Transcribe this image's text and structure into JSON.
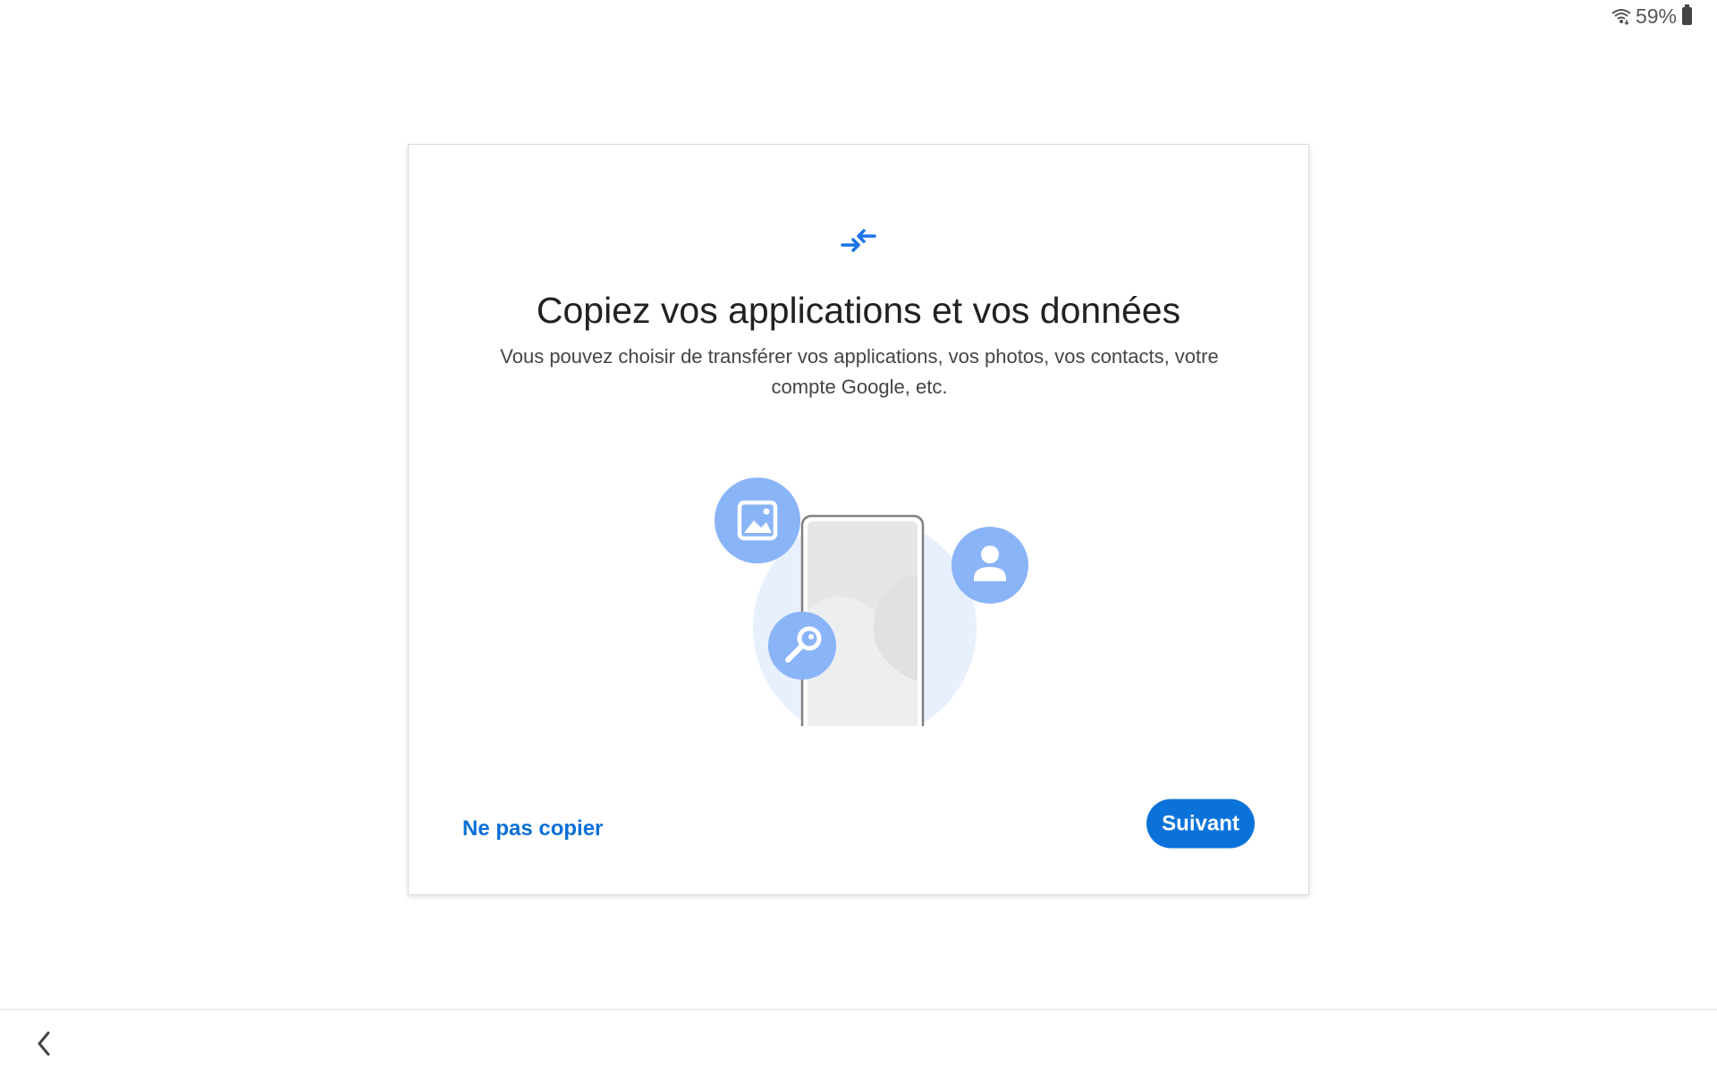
{
  "status_bar": {
    "wifi_icon": "wifi-icon",
    "battery_percent": "59%",
    "battery_icon": "battery-icon"
  },
  "dialog": {
    "header_icon": "transfer-arrows-icon",
    "title": "Copiez vos applications et vos données",
    "subtitle": "Vous pouvez choisir de transférer vos applications, vos photos, vos contacts, votre compte Google, etc.",
    "illustration_icons": [
      "image-icon",
      "person-icon",
      "key-icon",
      "phone-icon"
    ],
    "skip_label": "Ne pas copier",
    "next_label": "Suivant"
  },
  "nav_bar": {
    "back_icon": "chevron-left-icon"
  },
  "colors": {
    "accent": "#0b72da",
    "bubble": "#8ab4f8",
    "halo": "#e8f0fe"
  }
}
